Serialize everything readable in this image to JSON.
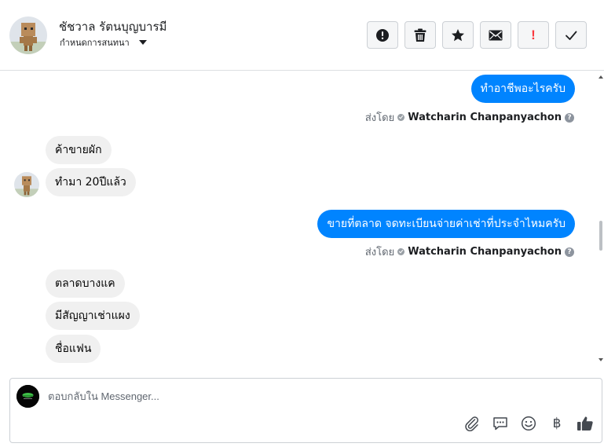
{
  "header": {
    "contact_name": "ชัชวาล รัตนบุญบารมี",
    "conversation_settings": "กำหนดการสนทนา",
    "toolbar": [
      {
        "id": "report",
        "icon": "exclamation-circle-icon"
      },
      {
        "id": "delete",
        "icon": "trash-icon"
      },
      {
        "id": "star",
        "icon": "star-icon"
      },
      {
        "id": "mark-unread",
        "icon": "envelope-icon"
      },
      {
        "id": "flag",
        "icon": "exclamation-mark-icon",
        "label": "!",
        "color": "#fa383e"
      },
      {
        "id": "done",
        "icon": "checkmark-icon"
      }
    ]
  },
  "thread": {
    "messages": [
      {
        "direction": "out",
        "text": "ทำอาชีพอะไรครับ"
      },
      {
        "direction": "in",
        "text": "ค้าขายผัก"
      },
      {
        "direction": "in",
        "text": "ทำมา 20ปีแล้ว"
      },
      {
        "direction": "out",
        "text": "ขายที่ตลาด จดทะเบียนจ่ายค่าเช่าที่ประจำไหมครับ"
      },
      {
        "direction": "in",
        "text": "ตลาดบางแค"
      },
      {
        "direction": "in",
        "text": "มีสัญญาเช่าแผง"
      },
      {
        "direction": "in",
        "text": "ชื่อแฟน"
      }
    ],
    "sent_by_prefix": "ส่งโดย",
    "sender_name": "Watcharin Chanpanyachon",
    "help_glyph": "?"
  },
  "composer": {
    "placeholder": "ตอบกลับใน Messenger...",
    "currency_glyph": "฿",
    "actions": [
      "paperclip-icon",
      "speech-bubble-icon",
      "smiley-icon",
      "baht-icon",
      "thumbs-up-icon"
    ]
  },
  "colors": {
    "outgoing_bubble": "#0084ff",
    "incoming_bubble": "#f0f0f0",
    "flag_red": "#fa383e"
  }
}
